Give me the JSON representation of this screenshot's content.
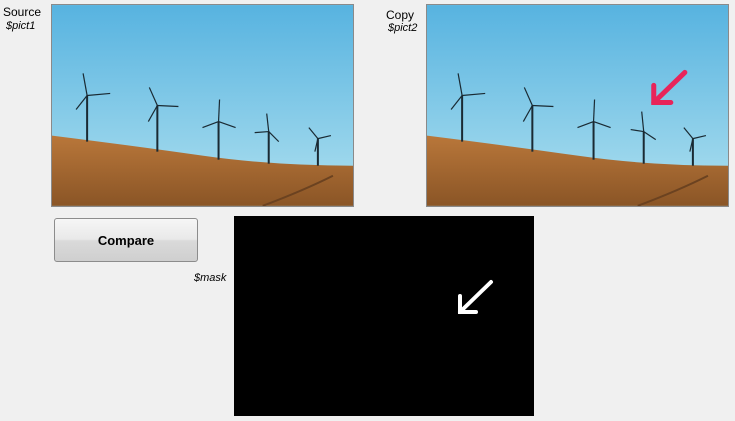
{
  "source": {
    "title": "Source",
    "variable": "$pict1"
  },
  "copy": {
    "title": "Copy",
    "variable": "$pict2"
  },
  "compare_button": {
    "label": "Compare"
  },
  "mask": {
    "variable": "$mask",
    "background": "#000000"
  },
  "colors": {
    "highlight_arrow": "#e8245a",
    "mask_arrow": "#ffffff",
    "sky": "#6fc2e6",
    "ground": "#a86c32"
  },
  "icons": {
    "copy_marker": "arrow-down-left-icon",
    "mask_marker": "arrow-down-left-icon"
  }
}
